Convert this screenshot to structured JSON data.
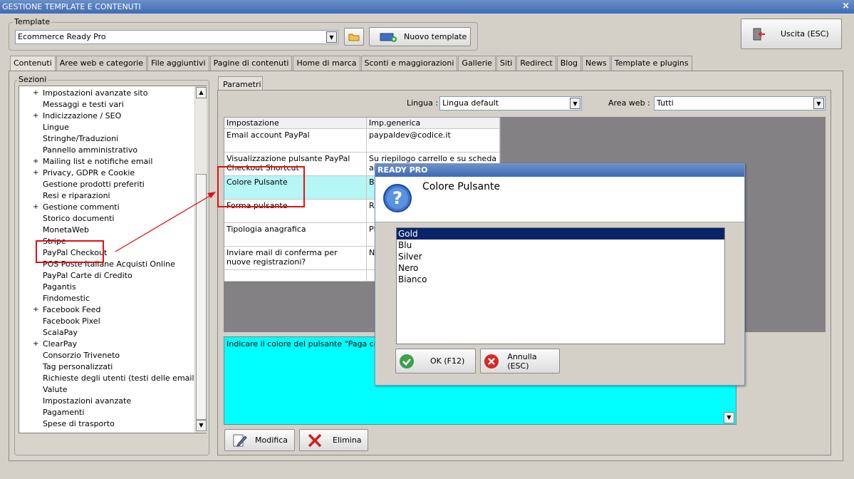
{
  "window": {
    "title": "GESTIONE TEMPLATE E CONTENUTI",
    "close": "×"
  },
  "template_group": {
    "legend": "Template",
    "selected": "Ecommerce Ready Pro",
    "new_label": "Nuovo template"
  },
  "exit_label": "Uscita (ESC)",
  "tabs": [
    "Contenuti",
    "Aree web e categorie",
    "File aggiuntivi",
    "Pagine di contenuti",
    "Home di marca",
    "Sconti e maggiorazioni",
    "Gallerie",
    "Siti",
    "Redirect",
    "Blog",
    "News",
    "Template e plugins"
  ],
  "sections": {
    "legend": "Sezioni",
    "items": [
      {
        "label": "Impostazioni avanzate sito",
        "expandable": true
      },
      {
        "label": "Messaggi e testi vari",
        "expandable": false
      },
      {
        "label": "Indicizzazione / SEO",
        "expandable": true
      },
      {
        "label": "Lingue",
        "expandable": false
      },
      {
        "label": "Stringhe/Traduzioni",
        "expandable": false
      },
      {
        "label": "Pannello amministrativo",
        "expandable": false
      },
      {
        "label": "Mailing list e notifiche email",
        "expandable": true
      },
      {
        "label": "Privacy, GDPR e Cookie",
        "expandable": true
      },
      {
        "label": "Gestione prodotti preferiti",
        "expandable": false
      },
      {
        "label": "Resi e riparazioni",
        "expandable": false
      },
      {
        "label": "Gestione commenti",
        "expandable": true
      },
      {
        "label": "Storico documenti",
        "expandable": false
      },
      {
        "label": "MonetaWeb",
        "expandable": false
      },
      {
        "label": "Stripe",
        "expandable": false
      },
      {
        "label": "PayPal Checkout",
        "expandable": false
      },
      {
        "label": "POS Poste Italiane Acquisti Online",
        "expandable": false
      },
      {
        "label": "PayPal Carte di Credito",
        "expandable": false
      },
      {
        "label": "Pagantis",
        "expandable": false
      },
      {
        "label": "Findomestic",
        "expandable": false
      },
      {
        "label": "Facebook Feed",
        "expandable": true
      },
      {
        "label": "Facebook Pixel",
        "expandable": false
      },
      {
        "label": "ScalaPay",
        "expandable": false
      },
      {
        "label": "ClearPay",
        "expandable": true
      },
      {
        "label": "Consorzio Triveneto",
        "expandable": false
      },
      {
        "label": "Tag personalizzati",
        "expandable": false
      },
      {
        "label": "Richieste degli utenti (testi delle email)",
        "expandable": false
      },
      {
        "label": "Valute",
        "expandable": false
      },
      {
        "label": "Impostazioni avanzate",
        "expandable": false
      },
      {
        "label": "Pagamenti",
        "expandable": false
      },
      {
        "label": "Spese di trasporto",
        "expandable": false
      }
    ]
  },
  "params": {
    "tab": "Parametri",
    "lingua_label": "Lingua :",
    "lingua_value": "Lingua default",
    "area_label": "Area web :",
    "area_value": "Tutti",
    "col_setting": "Impostazione",
    "col_generic": "Imp.generica",
    "rows": [
      {
        "name": "Email account PayPal",
        "value": "paypaldev@codice.it"
      },
      {
        "name": "Visualizzazione pulsante PayPal Checkout Shortcut",
        "value": "Su riepilogo carrello e su scheda ar"
      },
      {
        "name": "Colore Pulsante",
        "value": "Bl"
      },
      {
        "name": "Forma pulsante",
        "value": "Re"
      },
      {
        "name": "Tipologia anagrafica",
        "value": "PE"
      },
      {
        "name": "Inviare mail di conferma per nuove registrazioni?",
        "value": "No"
      }
    ],
    "description": "Indicare il colore del pulsante \"Paga con Pay",
    "modifica_label": "Modifica",
    "elimina_label": "Elimina"
  },
  "dialog": {
    "title": "READY PRO",
    "question": "Colore Pulsante",
    "options": [
      "Gold",
      "Blu",
      "Silver",
      "Nero",
      "Bianco"
    ],
    "selected_index": 0,
    "ok_label": "OK (F12)",
    "cancel_label": "Annulla (ESC)"
  },
  "colors": {
    "description_bg": "#00ffff",
    "selected_row_bg": "#b5f6f6",
    "highlight": "#e01010",
    "title_bar": "#4a74bb"
  }
}
